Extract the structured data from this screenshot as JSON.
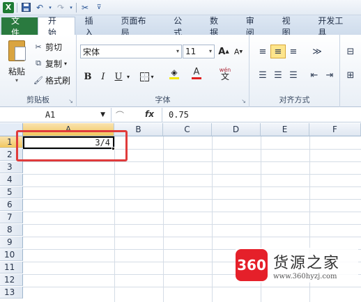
{
  "qat": {
    "icons": [
      "excel-logo",
      "save-icon",
      "undo-icon",
      "redo-icon",
      "format-painter-icon",
      "customize-qat-icon"
    ],
    "logo": "X"
  },
  "tabs": [
    "文件",
    "开始",
    "插入",
    "页面布局",
    "公式",
    "数据",
    "审阅",
    "视图",
    "开发工具"
  ],
  "active_tab": "开始",
  "clipboard": {
    "paste": "粘贴",
    "cut": "剪切",
    "copy": "复制",
    "format_painter": "格式刷",
    "label": "剪贴板"
  },
  "font": {
    "name": "宋体",
    "size": "11",
    "bold": "B",
    "italic": "I",
    "underline": "U",
    "grow": "A",
    "shrink": "A",
    "label": "字体",
    "wen": "wén"
  },
  "alignment": {
    "label": "对齐方式"
  },
  "formula_bar": {
    "name_box": "A1",
    "fx": "fx",
    "value": "0.75"
  },
  "columns": [
    "A",
    "B",
    "C",
    "D",
    "E",
    "F"
  ],
  "rows": [
    "1",
    "2",
    "3",
    "4",
    "5",
    "6",
    "7",
    "8",
    "9",
    "10",
    "11",
    "12",
    "13"
  ],
  "cell_a1": "3/4",
  "watermark": {
    "badge": "360",
    "title": "货源之家",
    "url": "www.360hyzj.com"
  },
  "colors": {
    "file_tab": "#2a7a3f",
    "highlight": "#e03b3b",
    "badge": "#e5202a"
  }
}
